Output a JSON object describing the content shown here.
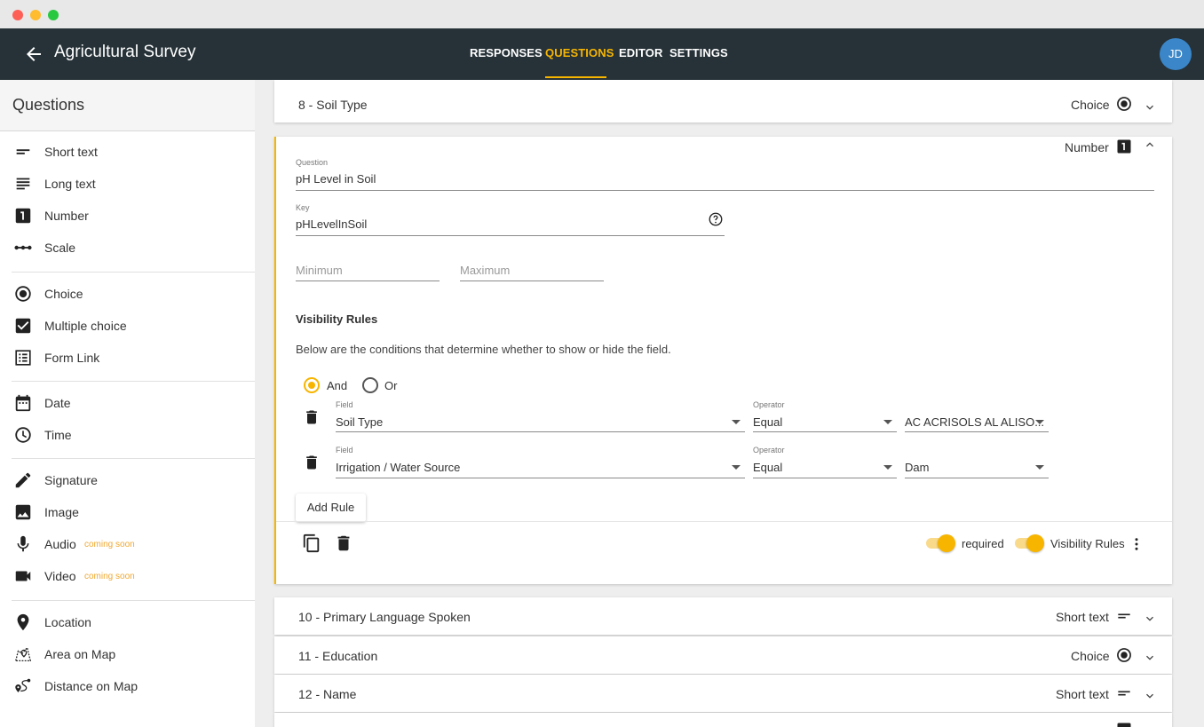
{
  "window": {
    "controls": [
      "close",
      "minimize",
      "maximize"
    ]
  },
  "appbar": {
    "back_icon": "arrow-back-icon",
    "title": "Agricultural Survey",
    "tabs": [
      {
        "label": "RESPONSES",
        "active": false
      },
      {
        "label": "QUESTIONS",
        "active": true
      },
      {
        "label": "EDITOR",
        "active": false
      },
      {
        "label": "SETTINGS",
        "active": false
      }
    ],
    "avatar_initials": "JD",
    "accent_color": "#f7b500",
    "bar_color": "#263238"
  },
  "sidebar": {
    "title": "Questions",
    "items": [
      {
        "label": "Short text",
        "icon": "short-text-icon"
      },
      {
        "label": "Long text",
        "icon": "long-text-icon"
      },
      {
        "label": "Number",
        "icon": "number-icon"
      },
      {
        "label": "Scale",
        "icon": "scale-icon"
      },
      {
        "label": "Choice",
        "icon": "radio-icon"
      },
      {
        "label": "Multiple choice",
        "icon": "checkbox-icon"
      },
      {
        "label": "Form Link",
        "icon": "list-icon"
      },
      {
        "label": "Date",
        "icon": "calendar-icon"
      },
      {
        "label": "Time",
        "icon": "clock-icon"
      },
      {
        "label": "Signature",
        "icon": "pencil-icon"
      },
      {
        "label": "Image",
        "icon": "image-icon"
      },
      {
        "label": "Audio",
        "icon": "microphone-icon",
        "badge": "coming soon"
      },
      {
        "label": "Video",
        "icon": "video-camera-icon",
        "badge": "coming soon"
      },
      {
        "label": "Location",
        "icon": "location-pin-icon"
      },
      {
        "label": "Area on Map",
        "icon": "map-area-icon"
      },
      {
        "label": "Distance on Map",
        "icon": "map-distance-icon"
      }
    ]
  },
  "questions": {
    "collapsed_top": {
      "title": "8 - Soil Type",
      "type": "Choice"
    },
    "expanded": {
      "type": "Number",
      "question_label": "Question",
      "question_value": "pH Level in Soil",
      "key_label": "Key",
      "key_value": "pHLevelInSoil",
      "minimum_placeholder": "Minimum",
      "maximum_placeholder": "Maximum",
      "visibility": {
        "title": "Visibility Rules",
        "description": "Below are the conditions that determine whether to show or hide the field.",
        "logic_options": [
          {
            "label": "And",
            "selected": true
          },
          {
            "label": "Or",
            "selected": false
          }
        ],
        "rules": [
          {
            "field_label": "Field",
            "field": "Soil Type",
            "operator_label": "Operator",
            "operator": "Equal",
            "value": "AC ACRISOLS AL ALISO..."
          },
          {
            "field_label": "Field",
            "field": "Irrigation / Water Source",
            "operator_label": "Operator",
            "operator": "Equal",
            "value": "Dam"
          }
        ],
        "add_rule_label": "Add Rule"
      },
      "footer": {
        "required_label": "required",
        "required_on": true,
        "visibility_label": "Visibility Rules",
        "visibility_on": true
      }
    },
    "collapsed_bottom": [
      {
        "title": "10 - Primary Language Spoken",
        "type": "Short text",
        "type_icon": "short-text-icon"
      },
      {
        "title": "11 - Education",
        "type": "Choice",
        "type_icon": "radio-icon"
      },
      {
        "title": "12 - Name",
        "type": "Short text",
        "type_icon": "short-text-icon"
      }
    ]
  }
}
